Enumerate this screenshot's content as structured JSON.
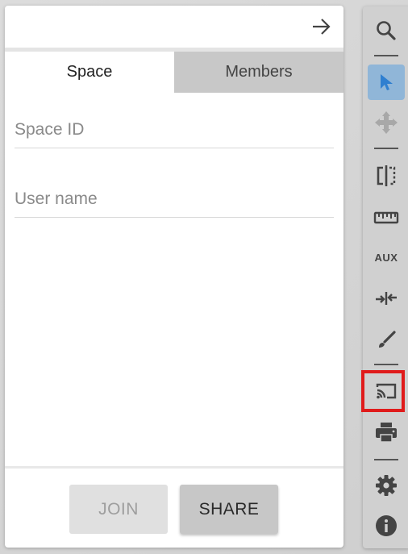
{
  "panel": {
    "tabs": [
      {
        "label": "Space",
        "active": true
      },
      {
        "label": "Members",
        "active": false
      }
    ],
    "fields": {
      "space_id": {
        "placeholder": "Space ID",
        "value": ""
      },
      "user_name": {
        "placeholder": "User name",
        "value": ""
      }
    },
    "buttons": {
      "join": {
        "label": "JOIN",
        "enabled": false
      },
      "share": {
        "label": "SHARE",
        "enabled": true
      }
    },
    "header_icon": "arrow-right-icon"
  },
  "toolbar": {
    "tools": [
      {
        "name": "search-icon"
      },
      {
        "name": "pointer-icon",
        "active": true
      },
      {
        "name": "move-icon",
        "enabled": false
      },
      {
        "name": "split-view-icon"
      },
      {
        "name": "ruler-icon"
      },
      {
        "name": "aux-icon",
        "label": "AUX"
      },
      {
        "name": "compare-icon"
      },
      {
        "name": "brush-icon"
      },
      {
        "name": "cast-icon",
        "highlighted": true
      },
      {
        "name": "print-icon"
      },
      {
        "name": "settings-icon"
      },
      {
        "name": "info-icon"
      }
    ]
  },
  "colors": {
    "active_tool": "#90b6d8",
    "highlight": "#e01b1b",
    "icon": "#444444"
  }
}
